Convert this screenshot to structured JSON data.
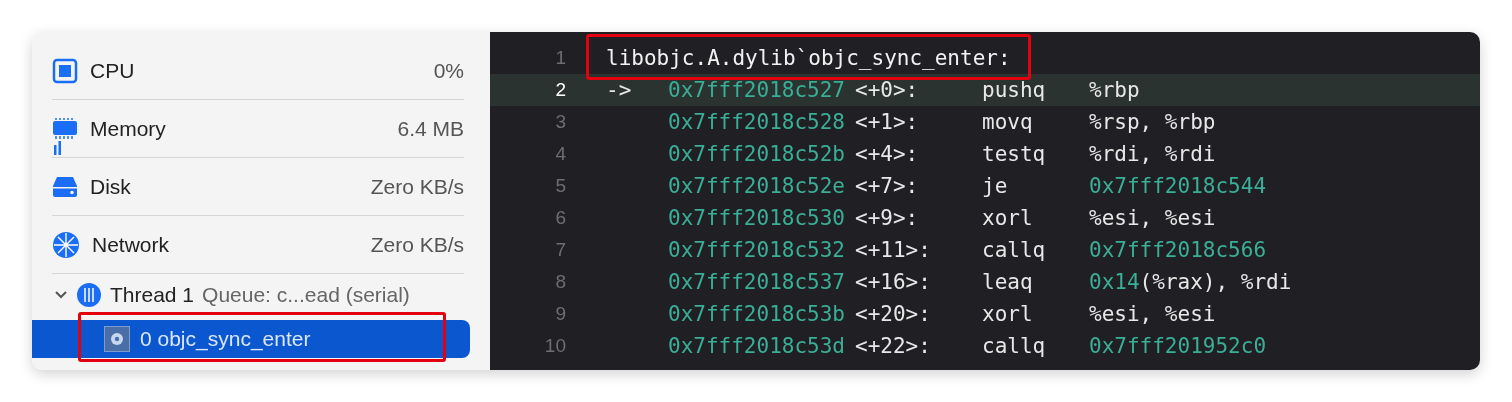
{
  "gauges": [
    {
      "kind": "cpu",
      "label": "CPU",
      "value": "0%"
    },
    {
      "kind": "memory",
      "label": "Memory",
      "value": "6.4 MB"
    },
    {
      "kind": "disk",
      "label": "Disk",
      "value": "Zero KB/s"
    },
    {
      "kind": "network",
      "label": "Network",
      "value": "Zero KB/s"
    }
  ],
  "thread": {
    "name": "Thread 1",
    "queue": "Queue: c...ead (serial)",
    "expanded": true,
    "frames": [
      {
        "label": "0 objc_sync_enter",
        "selected": true,
        "annotated": true
      }
    ]
  },
  "disassembly": [
    {
      "number": "1",
      "current": false,
      "kind": "label",
      "text": "libobjc.A.dylib`objc_sync_enter:",
      "annotated": true
    },
    {
      "number": "2",
      "current": true,
      "kind": "instruction",
      "arrow": "->",
      "address": "0x7fff2018c527",
      "offset": "<+0>:",
      "mnemonic": "pushq",
      "operands": [
        {
          "kind": "plain",
          "text": "%rbp"
        }
      ]
    },
    {
      "number": "3",
      "current": false,
      "kind": "instruction",
      "address": "0x7fff2018c528",
      "offset": "<+1>:",
      "mnemonic": "movq",
      "operands": [
        {
          "kind": "plain",
          "text": "%rsp, %rbp"
        }
      ]
    },
    {
      "number": "4",
      "current": false,
      "kind": "instruction",
      "address": "0x7fff2018c52b",
      "offset": "<+4>:",
      "mnemonic": "testq",
      "operands": [
        {
          "kind": "plain",
          "text": "%rdi, %rdi"
        }
      ]
    },
    {
      "number": "5",
      "current": false,
      "kind": "instruction",
      "address": "0x7fff2018c52e",
      "offset": "<+7>:",
      "mnemonic": "je",
      "operands": [
        {
          "kind": "number",
          "text": "0x7fff2018c544"
        }
      ]
    },
    {
      "number": "6",
      "current": false,
      "kind": "instruction",
      "address": "0x7fff2018c530",
      "offset": "<+9>:",
      "mnemonic": "xorl",
      "operands": [
        {
          "kind": "plain",
          "text": "%esi, %esi"
        }
      ]
    },
    {
      "number": "7",
      "current": false,
      "kind": "instruction",
      "address": "0x7fff2018c532",
      "offset": "<+11>:",
      "mnemonic": "callq",
      "operands": [
        {
          "kind": "number",
          "text": "0x7fff2018c566"
        }
      ]
    },
    {
      "number": "8",
      "current": false,
      "kind": "instruction",
      "address": "0x7fff2018c537",
      "offset": "<+16>:",
      "mnemonic": "leaq",
      "operands": [
        {
          "kind": "number",
          "text": "0x14"
        },
        {
          "kind": "plain",
          "text": "(%rax), %rdi"
        }
      ]
    },
    {
      "number": "9",
      "current": false,
      "kind": "instruction",
      "address": "0x7fff2018c53b",
      "offset": "<+20>:",
      "mnemonic": "xorl",
      "operands": [
        {
          "kind": "plain",
          "text": "%esi, %esi"
        }
      ]
    },
    {
      "number": "10",
      "current": false,
      "kind": "instruction",
      "address": "0x7fff2018c53d",
      "offset": "<+22>:",
      "mnemonic": "callq",
      "operands": [
        {
          "kind": "number",
          "text": "0x7fff201952c0"
        }
      ]
    }
  ]
}
